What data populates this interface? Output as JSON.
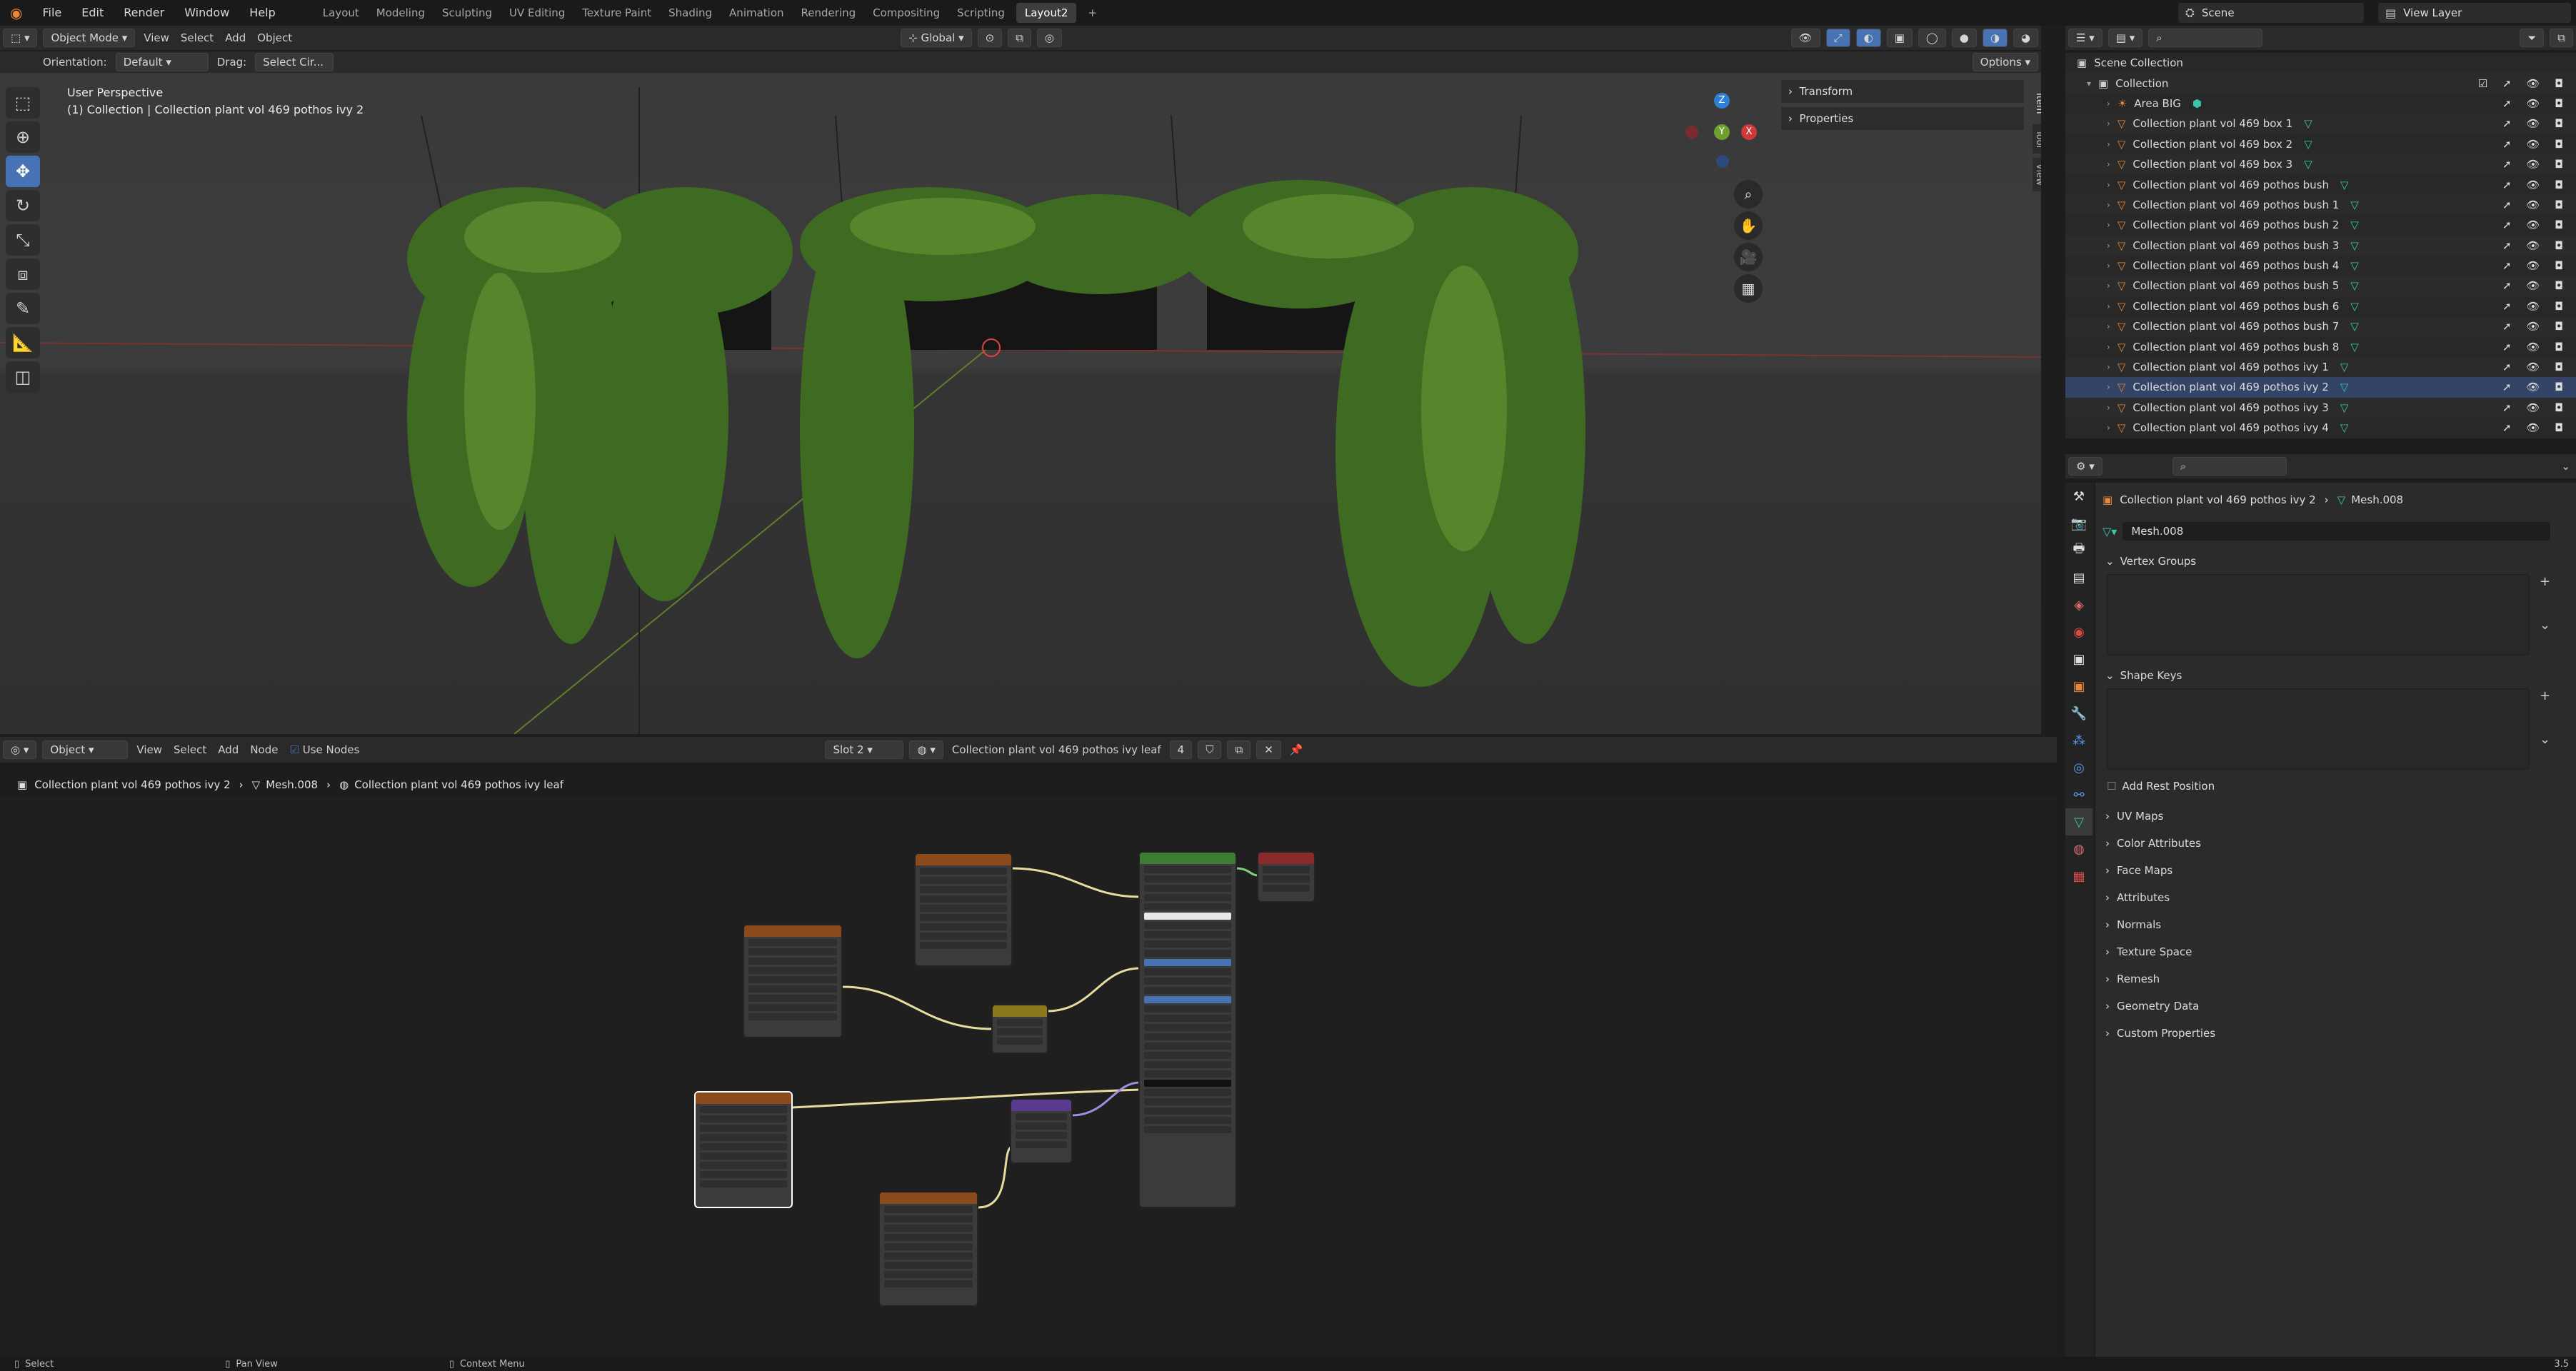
{
  "topbar": {
    "menus": [
      "File",
      "Edit",
      "Render",
      "Window",
      "Help"
    ],
    "workspaces": [
      "Layout",
      "Modeling",
      "Sculpting",
      "UV Editing",
      "Texture Paint",
      "Shading",
      "Animation",
      "Rendering",
      "Compositing",
      "Scripting",
      "Layout2"
    ],
    "active_workspace": "Layout2",
    "scene": "Scene",
    "view_layer": "View Layer"
  },
  "viewport": {
    "mode": "Object Mode",
    "menus": [
      "View",
      "Select",
      "Add",
      "Object"
    ],
    "transform_space": "Global",
    "orientation_label": "Orientation:",
    "orientation_value": "Default",
    "drag_label": "Drag:",
    "drag_value": "Select Cir...",
    "options_label": "Options",
    "title": "User Perspective",
    "subtitle": "(1) Collection | Collection plant vol 469 pothos ivy 2",
    "npanel": [
      "Transform",
      "Properties"
    ],
    "side_tabs": [
      "Item",
      "Tool",
      "View"
    ],
    "gizmo_axes": [
      "Z",
      "X",
      "Y"
    ]
  },
  "node_editor": {
    "type": "Object",
    "menus": [
      "View",
      "Select",
      "Add",
      "Node"
    ],
    "use_nodes": "Use Nodes",
    "slot": "Slot 2",
    "material": "Collection plant vol 469 pothos ivy leaf",
    "users": "4",
    "breadcrumb": [
      "Collection plant vol 469 pothos ivy 2",
      "Mesh.008",
      "Collection plant vol 469 pothos ivy leaf"
    ]
  },
  "outliner": {
    "root": "Scene Collection",
    "collection": "Collection",
    "items": [
      {
        "name": "Area BIG",
        "icon": "light"
      },
      {
        "name": "Collection plant vol 469 box 1",
        "icon": "mesh"
      },
      {
        "name": "Collection plant vol 469 box 2",
        "icon": "mesh"
      },
      {
        "name": "Collection plant vol 469 box 3",
        "icon": "mesh"
      },
      {
        "name": "Collection plant vol 469 pothos bush",
        "icon": "mesh"
      },
      {
        "name": "Collection plant vol 469 pothos bush 1",
        "icon": "mesh"
      },
      {
        "name": "Collection plant vol 469 pothos bush 2",
        "icon": "mesh"
      },
      {
        "name": "Collection plant vol 469 pothos bush 3",
        "icon": "mesh"
      },
      {
        "name": "Collection plant vol 469 pothos bush 4",
        "icon": "mesh"
      },
      {
        "name": "Collection plant vol 469 pothos bush 5",
        "icon": "mesh"
      },
      {
        "name": "Collection plant vol 469 pothos bush 6",
        "icon": "mesh"
      },
      {
        "name": "Collection plant vol 469 pothos bush 7",
        "icon": "mesh"
      },
      {
        "name": "Collection plant vol 469 pothos bush 8",
        "icon": "mesh"
      },
      {
        "name": "Collection plant vol 469 pothos ivy 1",
        "icon": "mesh"
      },
      {
        "name": "Collection plant vol 469 pothos ivy 2",
        "icon": "mesh"
      },
      {
        "name": "Collection plant vol 469 pothos ivy 3",
        "icon": "mesh"
      },
      {
        "name": "Collection plant vol 469 pothos ivy 4",
        "icon": "mesh"
      }
    ]
  },
  "properties": {
    "object_name": "Collection plant vol 469 pothos ivy 2",
    "mesh_name": "Mesh.008",
    "mesh_field": "Mesh.008",
    "vertex_groups": "Vertex Groups",
    "shape_keys": "Shape Keys",
    "add_rest_position": "Add Rest Position",
    "panels": [
      "UV Maps",
      "Color Attributes",
      "Face Maps",
      "Attributes",
      "Normals",
      "Texture Space",
      "Remesh",
      "Geometry Data",
      "Custom Properties"
    ]
  },
  "statusbar": {
    "select": "Select",
    "pan": "Pan View",
    "context": "Context Menu",
    "version": "3.5"
  },
  "colors": {
    "accent": "#4772b3",
    "image_node": "#8a4a1c",
    "bsdf_node": "#3e7d34",
    "normal_node": "#5a3a8a",
    "output_node": "#8a2a2a",
    "mix_node": "#8a7a1c"
  }
}
